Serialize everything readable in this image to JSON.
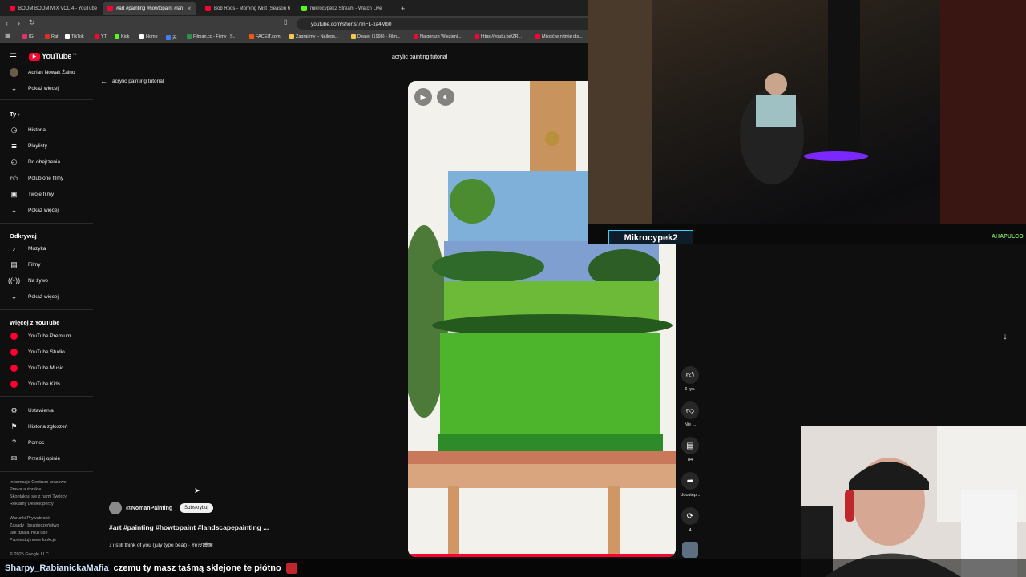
{
  "browser": {
    "tabs": [
      {
        "title": "BOOM BOOM MIX VOL.4 - YouTube",
        "fav": "#ff0033"
      },
      {
        "title": "#art #painting #howtopaint #lan",
        "fav": "#ff0033",
        "active": true
      },
      {
        "title": "Bob Roos - Morning Mist (Season 6",
        "fav": "#ff0033"
      },
      {
        "title": "mikrocypek2 Stream - Watch Live",
        "fav": "#53fc18"
      }
    ],
    "url": "youtube.com/shorts/7mFL-xa4Mb0",
    "bookmarks": [
      "IG",
      "Rat",
      "TikTok",
      "YT",
      "Kick",
      "Home",
      "天",
      "Filman.cc - Filmy i S...",
      "FACEIT.com",
      "Zagraj.my – Najleps...",
      "Dealer (1996) - Film...",
      "Najgorsze Więzieni...",
      "https://youtu.be/ZR...",
      "Miłość w rytmie dis..."
    ],
    "bookmark_colors": [
      "#e1306c",
      "#d93025",
      "#ffffff",
      "#ff0033",
      "#53fc18",
      "#ffffff",
      "#3b82f6",
      "#2b9348",
      "#ff5500",
      "#f2c94c",
      "#f2c94c",
      "#ff0033",
      "#ff0033",
      "#ff0033"
    ]
  },
  "youtube": {
    "logo_text": "YouTube",
    "logo_region": "PL",
    "account_name": "Adrian Nowak Żalno",
    "show_more": "Pokaż więcej",
    "you_section": "Ty",
    "you_items": [
      "Historia",
      "Playlisty",
      "Do obejrzenia",
      "Polubione filmy",
      "Twoje filmy",
      "Pokaż więcej"
    ],
    "explore_title": "Odkrywaj",
    "explore_items": [
      "Muzyka",
      "Filmy",
      "Na żywo",
      "Pokaż więcej"
    ],
    "more_title": "Więcej z YouTube",
    "more_items": [
      "YouTube Premium",
      "YouTube Studio",
      "YouTube Music",
      "YouTube Kids"
    ],
    "settings_items": [
      "Ustawienia",
      "Historia zgłoszeń",
      "Pomoc",
      "Prześlij opinię"
    ],
    "footer": [
      "Informacje  Centrum prasowe",
      "Prawa autorskie",
      "Skontaktuj się z nami  Twórcy",
      "Reklamy  Deweloperzy",
      "",
      "Warunki  Prywatność",
      "Zasady i bezpieczeństwo",
      "Jak działa YouTube",
      "Przetestuj nowe funkcje",
      "",
      "© 2025 Google LLC"
    ],
    "search_query": "acrylic painting tutorial",
    "back_label": "acrylic painting tutorial",
    "channel": "@NomanPainting",
    "subscribe": "Subskrybuj",
    "video_title": "#art #painting #howtopaint #landscapepainting ...",
    "music": "♪ i still think of you  (july type beat)  · Ye没睡醒",
    "likes": "6 tys.",
    "dislike": "Nie ...",
    "comments": "84",
    "share": "Udostęp...",
    "remix": "4"
  },
  "stream": {
    "streamer_tag": "Mikrocypek2",
    "corner_logo": "AHAPULCO",
    "chat_user": "Sharpy_RabianickaMafia",
    "chat_message": "czemu ty masz taśmą sklejone te płótno"
  }
}
